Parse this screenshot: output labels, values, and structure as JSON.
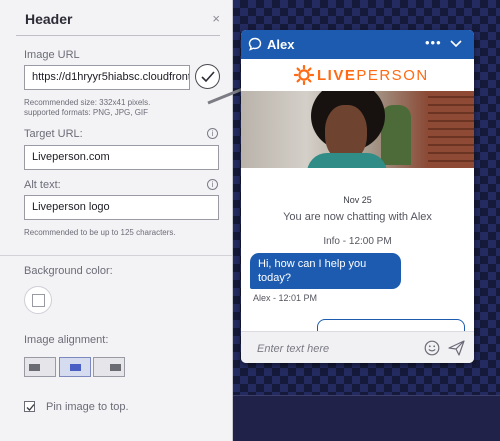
{
  "panel": {
    "title": "Header",
    "close_icon": "close-icon",
    "image_url": {
      "label": "Image URL",
      "value": "https://d1hryyr5hiabsc.cloudfront.",
      "hint_line1": "Recommended size: 332x41 pixels.",
      "hint_line2": "supported formats: PNG, JPG, GIF"
    },
    "target_url": {
      "label": "Target URL:",
      "value": "Liveperson.com",
      "info": "i"
    },
    "alt_text": {
      "label": "Alt text:",
      "value": "Liveperson logo",
      "info": "i",
      "hint": "Recommended to be up to 125 characters."
    },
    "background_color": {
      "label": "Background color:",
      "color": "#ffffff"
    },
    "image_alignment": {
      "label": "Image alignment:",
      "options": [
        "left",
        "center",
        "right"
      ],
      "selected": "center"
    },
    "pin": {
      "label": "Pin image to top.",
      "checked": true
    }
  },
  "chat": {
    "agent_name": "Alex",
    "more_label": "•••",
    "brand": {
      "word1": "LIVE",
      "word2": "PERSON",
      "color": "#ff6a13"
    },
    "date": "Nov 25",
    "system_message": "You are now chatting with Alex",
    "info_line": "Info - 12:00 PM",
    "agent_message": "Hi, how can I help you today?",
    "agent_meta": "Alex - 12:01 PM",
    "input_placeholder": "Enter text here",
    "accent_color": "#1c5bb0"
  }
}
